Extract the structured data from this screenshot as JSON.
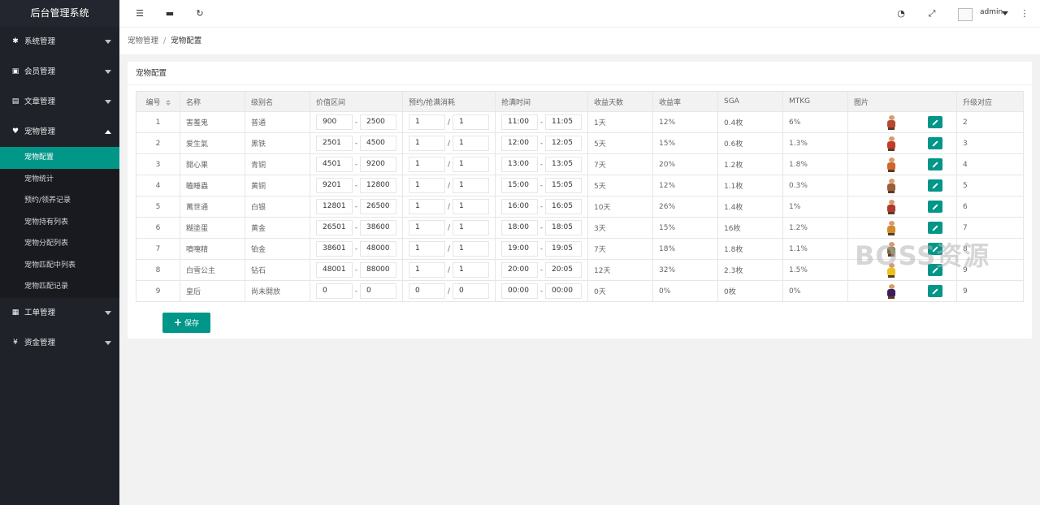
{
  "app_title": "后台管理系统",
  "sidebar": {
    "groups": [
      {
        "label": "系统管理",
        "icon": "gear-icon"
      },
      {
        "label": "会员管理",
        "icon": "users-icon"
      },
      {
        "label": "文章管理",
        "icon": "copy-icon"
      },
      {
        "label": "宠物管理",
        "icon": "heart-icon"
      },
      {
        "label": "工单管理",
        "icon": "file-icon"
      },
      {
        "label": "资金管理",
        "icon": "yen-icon"
      }
    ],
    "pet_items": [
      "宠物配置",
      "宠物统计",
      "预约/领养记录",
      "宠物持有列表",
      "宠物分配列表",
      "宠物匹配中列表",
      "宠物匹配记录"
    ]
  },
  "header": {
    "user": "admin"
  },
  "breadcrumb": {
    "parent": "宠物管理",
    "sep": "/",
    "current": "宠物配置"
  },
  "card": {
    "title": "宠物配置"
  },
  "table": {
    "headers": [
      "编号",
      "名称",
      "级别名",
      "价值区间",
      "预约/抢满消耗",
      "抢满时间",
      "收益天数",
      "收益率",
      "SGA",
      "MTKG",
      "图片",
      "升级对应"
    ],
    "rows": [
      {
        "id": "1",
        "name": "害羞鬼",
        "level": "普通",
        "vmin": "900",
        "vmax": "2500",
        "c1": "1",
        "c2": "1",
        "t1": "11:00",
        "t2": "11:05",
        "days": "1天",
        "rate": "12%",
        "sga": "0.4枚",
        "mtkg": "6%",
        "up": "2",
        "color": "#b9482f"
      },
      {
        "id": "2",
        "name": "爱生氣",
        "level": "黑铁",
        "vmin": "2501",
        "vmax": "4500",
        "c1": "1",
        "c2": "1",
        "t1": "12:00",
        "t2": "12:05",
        "days": "5天",
        "rate": "15%",
        "sga": "0.6枚",
        "mtkg": "1.3%",
        "up": "3",
        "color": "#c43b2a"
      },
      {
        "id": "3",
        "name": "開心果",
        "level": "青铜",
        "vmin": "4501",
        "vmax": "9200",
        "c1": "1",
        "c2": "1",
        "t1": "13:00",
        "t2": "13:05",
        "days": "7天",
        "rate": "20%",
        "sga": "1.2枚",
        "mtkg": "1.8%",
        "up": "4",
        "color": "#d0662c"
      },
      {
        "id": "4",
        "name": "瞌睡蟲",
        "level": "黄铜",
        "vmin": "9201",
        "vmax": "12800",
        "c1": "1",
        "c2": "1",
        "t1": "15:00",
        "t2": "15:05",
        "days": "5天",
        "rate": "12%",
        "sga": "1.1枚",
        "mtkg": "0.3%",
        "up": "5",
        "color": "#9c5d3a"
      },
      {
        "id": "5",
        "name": "萬世通",
        "level": "白银",
        "vmin": "12801",
        "vmax": "26500",
        "c1": "1",
        "c2": "1",
        "t1": "16:00",
        "t2": "16:05",
        "days": "10天",
        "rate": "26%",
        "sga": "1.4枚",
        "mtkg": "1%",
        "up": "6",
        "color": "#b03a2e"
      },
      {
        "id": "6",
        "name": "糊塗蛋",
        "level": "黄金",
        "vmin": "26501",
        "vmax": "38600",
        "c1": "1",
        "c2": "1",
        "t1": "18:00",
        "t2": "18:05",
        "days": "3天",
        "rate": "15%",
        "sga": "16枚",
        "mtkg": "1.2%",
        "up": "7",
        "color": "#d08a2a"
      },
      {
        "id": "7",
        "name": "噴嚏精",
        "level": "铂金",
        "vmin": "38601",
        "vmax": "48000",
        "c1": "1",
        "c2": "1",
        "t1": "19:00",
        "t2": "19:05",
        "days": "7天",
        "rate": "18%",
        "sga": "1.8枚",
        "mtkg": "1.1%",
        "up": "8",
        "color": "#7a6a3a"
      },
      {
        "id": "8",
        "name": "白雪公主",
        "level": "钻石",
        "vmin": "48001",
        "vmax": "88000",
        "c1": "1",
        "c2": "1",
        "t1": "20:00",
        "t2": "20:05",
        "days": "12天",
        "rate": "32%",
        "sga": "2.3枚",
        "mtkg": "1.5%",
        "up": "9",
        "color": "#e6c21c"
      },
      {
        "id": "9",
        "name": "皇后",
        "level": "尚未開放",
        "vmin": "0",
        "vmax": "0",
        "c1": "0",
        "c2": "0",
        "t1": "00:00",
        "t2": "00:00",
        "days": "0天",
        "rate": "0%",
        "sga": "0枚",
        "mtkg": "0%",
        "up": "9",
        "color": "#3b1f5a"
      }
    ]
  },
  "save_label": "保存",
  "watermark": "BOSS资源"
}
